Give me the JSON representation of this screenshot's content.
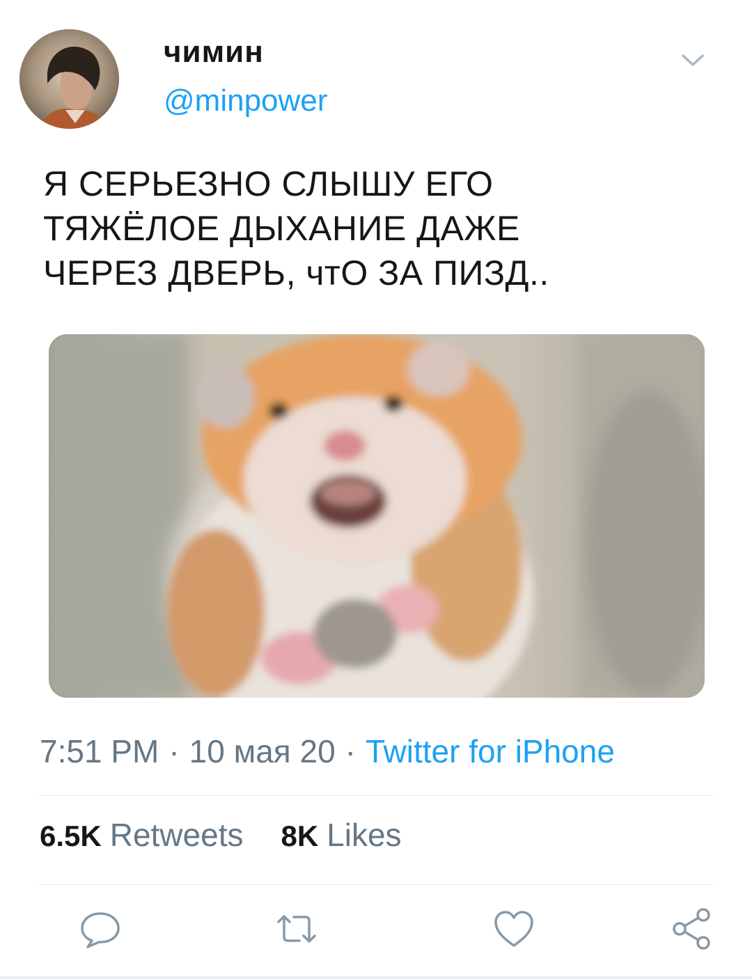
{
  "user": {
    "display_name": "чимин",
    "handle": "@minpower"
  },
  "tweet": {
    "text": "Я СЕРЬЕЗНО СЛЫШУ ЕГО\nТЯЖЁЛОЕ ДЫХАНИЕ ДАЖЕ\nЧЕРЕЗ ДВЕРЬ, чтО ЗА ПИЗД..",
    "time": "7:51 PM",
    "separator": "·",
    "date": "10 мая 20",
    "source": "Twitter for iPhone"
  },
  "stats": {
    "retweets_count": "6.5K",
    "retweets_label": "Retweets",
    "likes_count": "8K",
    "likes_label": "Likes"
  },
  "icons": {
    "caret": "chevron-down-icon",
    "reply": "reply-icon",
    "retweet": "retweet-icon",
    "like": "heart-icon",
    "share": "share-icon"
  },
  "colors": {
    "accent": "#1da1f2",
    "secondary_text": "#657786",
    "divider": "#e1e8ed"
  }
}
